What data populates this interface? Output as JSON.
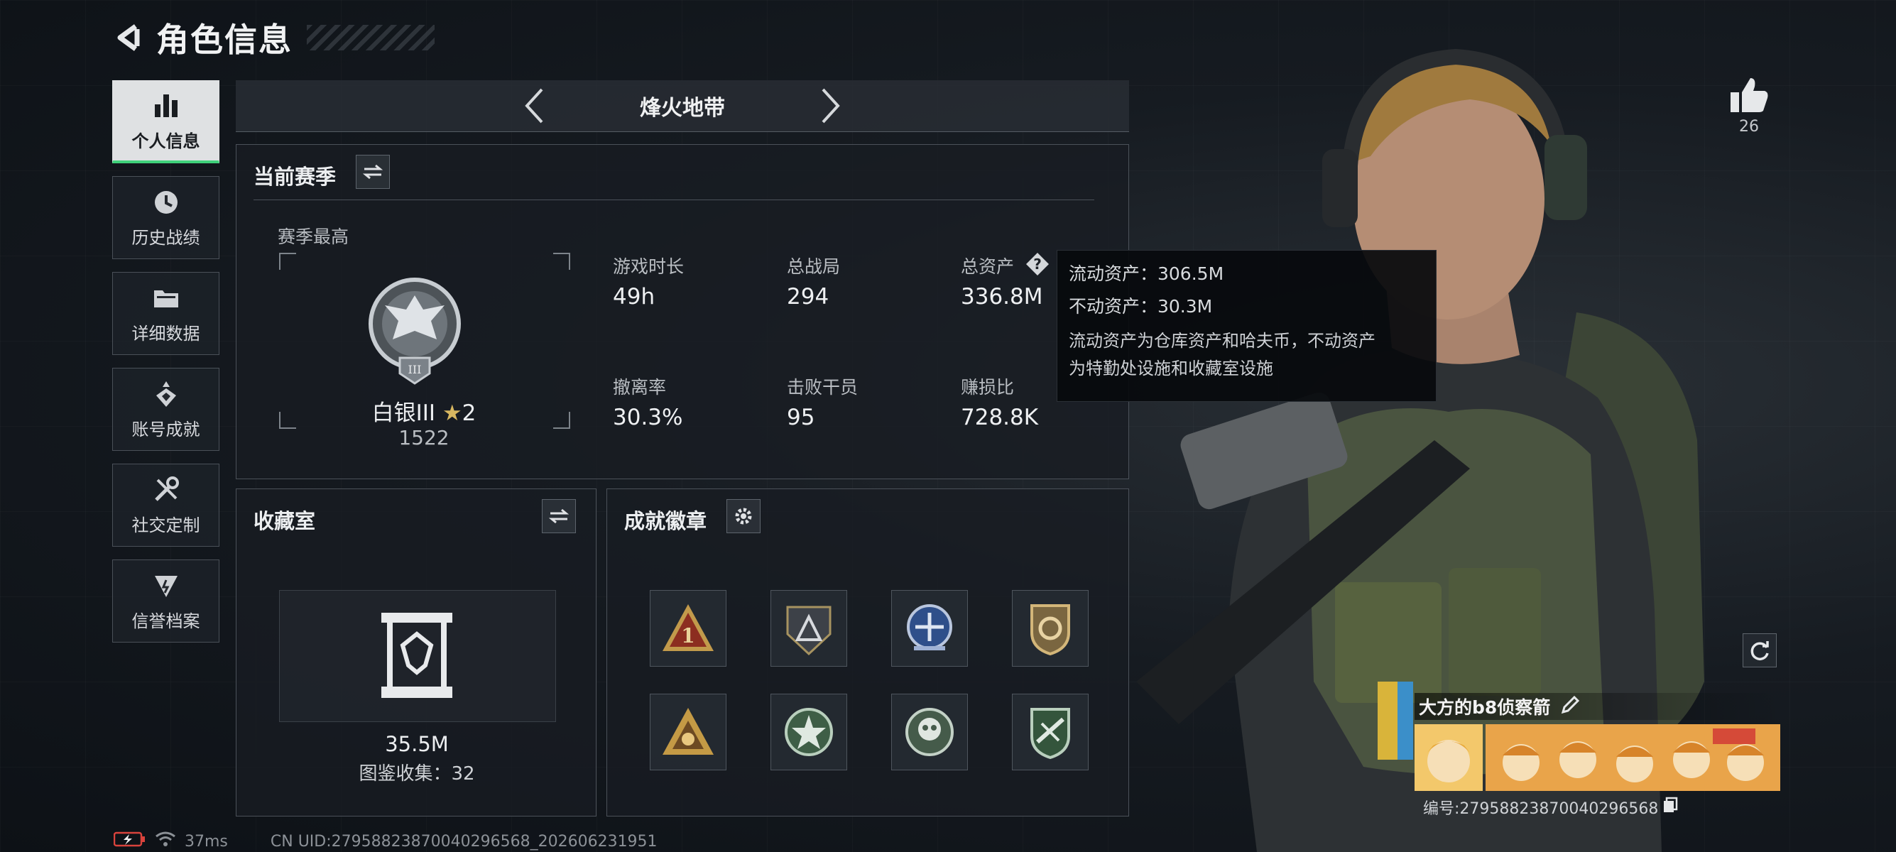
{
  "header": {
    "title": "角色信息"
  },
  "sidebar": {
    "items": [
      {
        "label": "个人信息",
        "icon": "bar-chart-icon",
        "active": true
      },
      {
        "label": "历史战绩",
        "icon": "history-clock-icon"
      },
      {
        "label": "详细数据",
        "icon": "folder-icon"
      },
      {
        "label": "账号成就",
        "icon": "achievement-icon"
      },
      {
        "label": "社交定制",
        "icon": "tools-icon"
      },
      {
        "label": "信誉档案",
        "icon": "reputation-icon"
      }
    ]
  },
  "mode": {
    "label": "烽火地带"
  },
  "season": {
    "title": "当前赛季",
    "best_label": "赛季最高",
    "rank_name": "白银III",
    "rank_stars": "2",
    "rank_score": "1522",
    "stats": [
      {
        "label": "游戏时长",
        "value": "49h"
      },
      {
        "label": "总战局",
        "value": "294"
      },
      {
        "label": "总资产",
        "value": "336.8M"
      },
      {
        "label": "撤离率",
        "value": "30.3%"
      },
      {
        "label": "击败干员",
        "value": "95"
      },
      {
        "label": "赚损比",
        "value": "728.8K"
      }
    ]
  },
  "tooltip": {
    "liquid": "流动资产：306.5M",
    "fixed": "不动资产：30.3M",
    "desc_line1": "流动资产为仓库资产和哈夫币，不动资产",
    "desc_line2": "为特勤处设施和收藏室设施"
  },
  "collection": {
    "title": "收藏室",
    "value": "35.5M",
    "catalog": "图鉴收集：32"
  },
  "badges": {
    "title": "成就徽章",
    "items": [
      "rank-one-badge",
      "triangle-shield-badge",
      "blue-emblem-badge",
      "gold-shield-badge",
      "gold-triangle-badge",
      "green-star-badge",
      "green-skull-badge",
      "green-rifle-badge"
    ]
  },
  "character": {
    "likes": "26",
    "name": "大方的b8侦察箭",
    "id_text": "编号:2795882387004029656​8"
  },
  "footer": {
    "ping": "37ms",
    "uid": "CN UID:2795882387004029656​8_202606231951"
  }
}
